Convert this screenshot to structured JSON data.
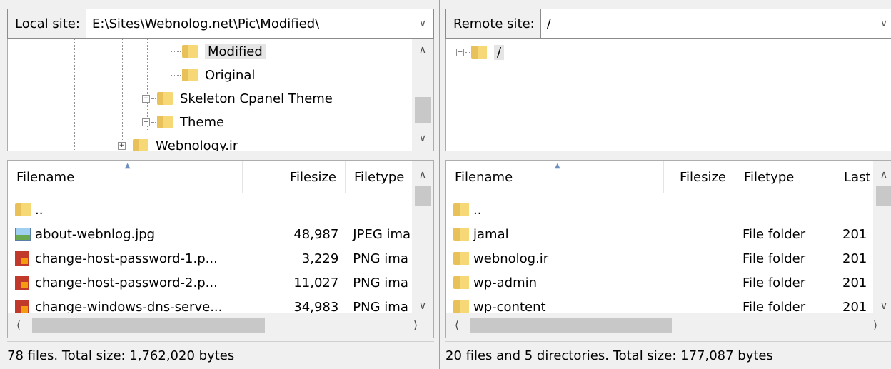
{
  "local": {
    "site_label": "Local site:",
    "site_path": "E:\\Sites\\Webnolog.net\\Pic\\Modified\\",
    "tree": [
      {
        "label": "Modified",
        "selected": true
      },
      {
        "label": "Original",
        "selected": false
      },
      {
        "label": "Skeleton Cpanel Theme",
        "selected": false
      },
      {
        "label": "Theme",
        "selected": false
      },
      {
        "label": "Webnology.ir",
        "selected": false
      }
    ],
    "columns": {
      "filename": "Filename",
      "filesize": "Filesize",
      "filetype": "Filetype"
    },
    "rows": [
      {
        "icon": "folder-icon",
        "name": "..",
        "size": "",
        "type": ""
      },
      {
        "icon": "jpeg-image-icon",
        "name": "about-webnlog.jpg",
        "size": "48,987",
        "type": "JPEG ima"
      },
      {
        "icon": "png-image-icon",
        "name": "change-host-password-1.p...",
        "size": "3,229",
        "type": "PNG ima"
      },
      {
        "icon": "png-image-icon",
        "name": "change-host-password-2.p...",
        "size": "11,027",
        "type": "PNG ima"
      },
      {
        "icon": "png-image-icon",
        "name": "change-windows-dns-serve...",
        "size": "34,983",
        "type": "PNG ima"
      }
    ],
    "status": "78 files. Total size: 1,762,020 bytes"
  },
  "remote": {
    "site_label": "Remote site:",
    "site_path": "/",
    "tree": [
      {
        "label": "/",
        "selected": true
      }
    ],
    "columns": {
      "filename": "Filename",
      "filesize": "Filesize",
      "filetype": "Filetype",
      "last": "Last"
    },
    "rows": [
      {
        "icon": "folder-icon",
        "name": "..",
        "type": "",
        "last": ""
      },
      {
        "icon": "folder-icon",
        "name": "jamal",
        "type": "File folder",
        "last": "201"
      },
      {
        "icon": "folder-icon",
        "name": "webnolog.ir",
        "type": "File folder",
        "last": "201"
      },
      {
        "icon": "folder-icon",
        "name": "wp-admin",
        "type": "File folder",
        "last": "201"
      },
      {
        "icon": "folder-icon",
        "name": "wp-content",
        "type": "File folder",
        "last": "201"
      }
    ],
    "status": "20 files and 5 directories. Total size: 177,087 bytes"
  },
  "icons": {
    "dropdown": "chevron-down-icon",
    "scroll_up": "chevron-up-icon",
    "scroll_down": "chevron-down-icon",
    "scroll_left": "chevron-left-icon",
    "scroll_right": "chevron-right-icon",
    "expand": "plus-box-icon"
  }
}
